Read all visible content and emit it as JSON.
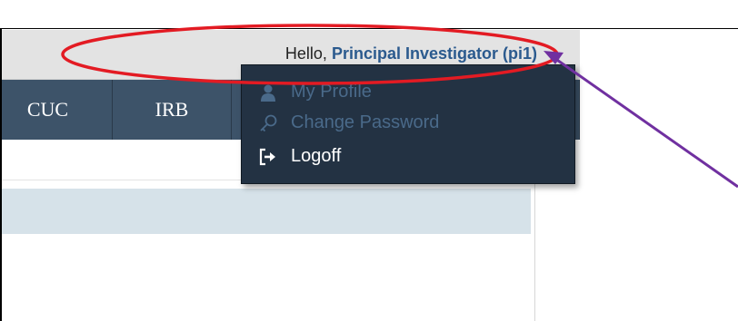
{
  "header": {
    "greeting": "Hello,",
    "user_name": "Principal Investigator (pi1)"
  },
  "nav": {
    "tabs": [
      {
        "label": "CUC"
      },
      {
        "label": "IRB"
      }
    ]
  },
  "dropdown": {
    "items": [
      {
        "label": "My Profile",
        "icon": "user-icon"
      },
      {
        "label": "Change Password",
        "icon": "key-icon"
      },
      {
        "label": "Logoff",
        "icon": "logoff-icon"
      }
    ]
  },
  "colors": {
    "nav_bg": "#3d5369",
    "dropdown_bg": "#233243",
    "user_name": "#2b5a8e",
    "annotation_circle": "#e31b23",
    "annotation_arrow": "#7030a0"
  }
}
